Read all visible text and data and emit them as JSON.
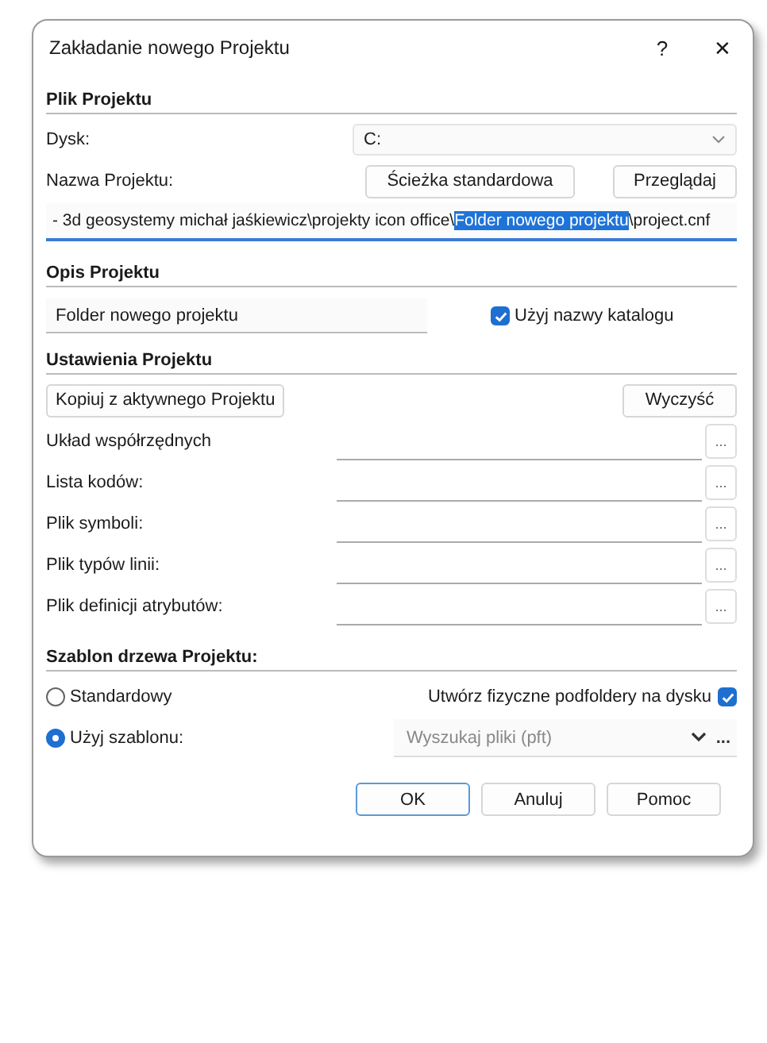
{
  "window": {
    "title": "Zakładanie nowego Projektu",
    "help": "?",
    "close": "✕"
  },
  "plik": {
    "heading": "Plik Projektu",
    "drive_label": "Dysk:",
    "drive_value": "C:",
    "name_label": "Nazwa Projektu:",
    "buttons": [
      "Ścieżka standardowa",
      "Przeglądaj"
    ],
    "path": {
      "before": " - 3d geosystemy michał jaśkiewicz\\projekty icon office\\",
      "selected": "Folder nowego projektu",
      "after": "\\project.cnf"
    }
  },
  "opis": {
    "heading": "Opis Projektu",
    "value": "Folder nowego projektu",
    "checkbox": {
      "label": "Użyj nazwy katalogu",
      "checked": true
    }
  },
  "ustawienia": {
    "heading": "Ustawienia Projektu",
    "copy_button": "Kopiuj z aktywnego Projektu",
    "clear_button": "Wyczyść",
    "rows": [
      {
        "label": "Układ współrzędnych",
        "browse": "..."
      },
      {
        "label": "Lista kodów:",
        "browse": "..."
      },
      {
        "label": "Plik symboli:",
        "browse": "..."
      },
      {
        "label": "Plik typów linii:",
        "browse": "..."
      },
      {
        "label": "Plik definicji atrybutów:",
        "browse": "..."
      }
    ]
  },
  "szablon": {
    "heading": "Szablon drzewa Projektu:",
    "radios": [
      {
        "label": "Standardowy",
        "selected": false
      },
      {
        "label": "Użyj szablonu:",
        "selected": true
      }
    ],
    "subfolders": {
      "label": "Utwórz fizyczne podfoldery na dysku",
      "checked": true
    },
    "template_placeholder": "Wyszukaj pliki (pft)",
    "browse": "..."
  },
  "buttons": [
    {
      "label": "OK",
      "default": true
    },
    {
      "label": "Anuluj",
      "default": false
    },
    {
      "label": "Pomoc",
      "default": false
    }
  ]
}
